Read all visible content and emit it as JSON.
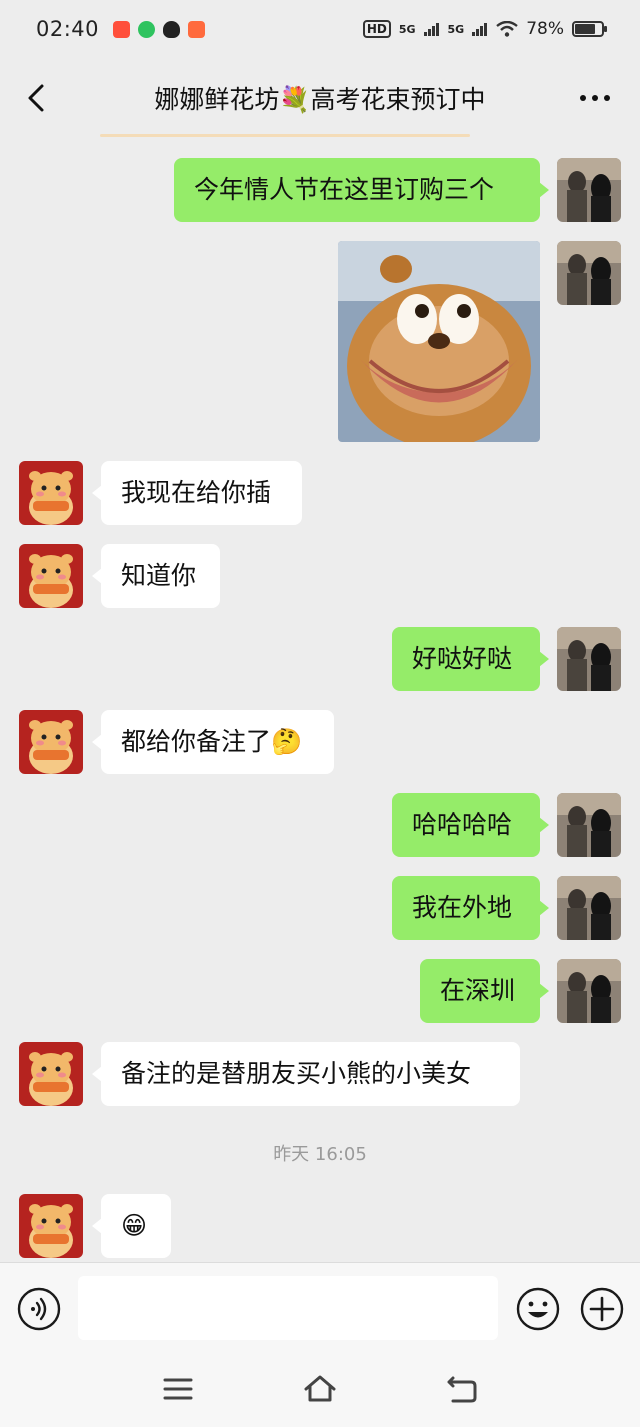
{
  "status_bar": {
    "time": "02:40",
    "app_icons": [
      "taobao-icon",
      "music-icon",
      "qq-icon",
      "xiaohongshu-icon"
    ],
    "hd_label": "HD",
    "network1": "5G",
    "network2": "5G",
    "battery": "78%",
    "battery_level": 0.78
  },
  "header": {
    "title": "娜娜鲜花坊💐高考花束预订中"
  },
  "messages": [
    {
      "side": "sent",
      "type": "text",
      "text": "今年情人节在这里订购三个"
    },
    {
      "side": "sent",
      "type": "sticker",
      "sticker": "bear-grin-sticker"
    },
    {
      "side": "recv",
      "type": "text",
      "text": "我现在给你插"
    },
    {
      "side": "recv",
      "type": "text",
      "text": "知道你"
    },
    {
      "side": "sent",
      "type": "text",
      "text": "好哒好哒"
    },
    {
      "side": "recv",
      "type": "text",
      "text": "都给你备注了🤔"
    },
    {
      "side": "sent",
      "type": "text",
      "text": "哈哈哈哈"
    },
    {
      "side": "sent",
      "type": "text",
      "text": "我在外地"
    },
    {
      "side": "sent",
      "type": "text",
      "text": "在深圳"
    },
    {
      "side": "recv",
      "type": "text",
      "text": "备注的是替朋友买小熊的小美女"
    },
    {
      "side": "recv",
      "type": "text",
      "text": "😁"
    }
  ],
  "timestamp": "昨天 16:05",
  "input": {
    "value": "",
    "placeholder": ""
  },
  "colors": {
    "sent_bubble": "#95ec69",
    "recv_bubble": "#ffffff",
    "background": "#ededed"
  }
}
